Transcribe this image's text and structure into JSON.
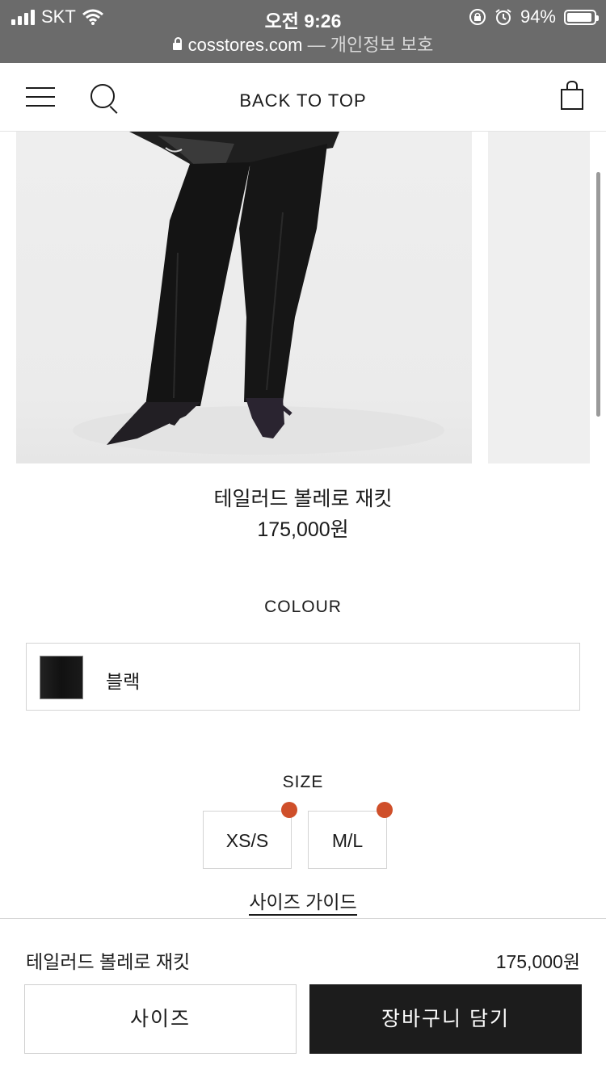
{
  "status_bar": {
    "carrier": "SKT",
    "time": "오전 9:26",
    "battery_percent": "94%",
    "battery_level": 0.94,
    "url_domain": "cosstores.com",
    "url_separator": "—",
    "url_privacy": "개인정보 보호"
  },
  "header": {
    "back_to_top": "BACK TO TOP"
  },
  "product": {
    "name": "테일러드 볼레로 재킷",
    "price": "175,000원"
  },
  "colour": {
    "label": "COLOUR",
    "selected_name": "블랙",
    "swatch_color": "#151515"
  },
  "size": {
    "label": "SIZE",
    "options": [
      "XS/S",
      "M/L"
    ],
    "indicator_color": "#cf4f2a",
    "guide_link": "사이즈 가이드"
  },
  "bottom_bar": {
    "product_name": "테일러드 볼레로 재킷",
    "price": "175,000원",
    "size_button": "사이즈",
    "cart_button": "장바구니 담기"
  }
}
